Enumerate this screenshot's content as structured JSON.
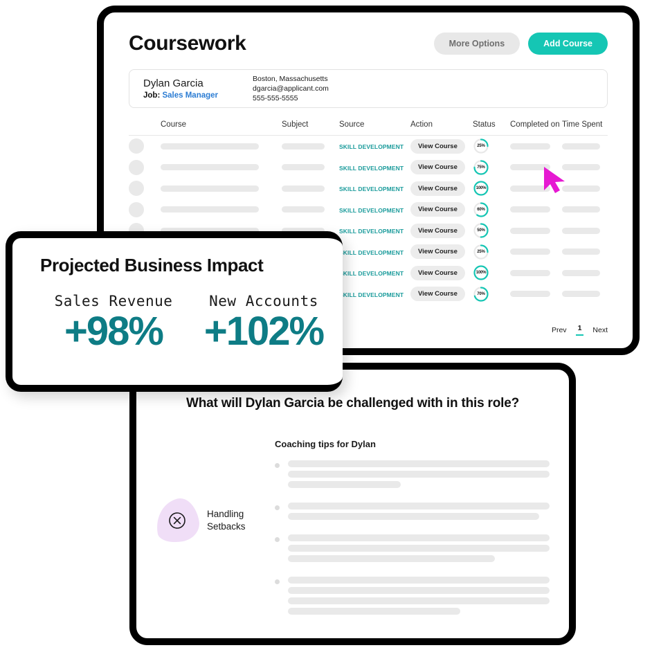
{
  "coursework": {
    "title": "Coursework",
    "more_options_label": "More Options",
    "add_course_label": "Add Course",
    "person": {
      "name": "Dylan Garcia",
      "job_prefix": "Job:",
      "job_title": "Sales Manager",
      "location": "Boston, Massachusetts",
      "email": "dgarcia@applicant.com",
      "phone": "555-555-5555"
    },
    "table": {
      "headers": [
        "Course",
        "Subject",
        "Source",
        "Action",
        "Status",
        "Completed on",
        "Time Spent"
      ],
      "source_label": "SKILL DEVELOPMENT",
      "action_label": "View Course",
      "rows": [
        {
          "status": "25%",
          "percent": 25
        },
        {
          "status": "75%",
          "percent": 75
        },
        {
          "status": "100%",
          "percent": 100
        },
        {
          "status": "60%",
          "percent": 60
        },
        {
          "status": "50%",
          "percent": 50
        },
        {
          "status": "25%",
          "percent": 25
        },
        {
          "status": "100%",
          "percent": 100
        },
        {
          "status": "70%",
          "percent": 70
        }
      ]
    },
    "pagination": {
      "prev": "Prev",
      "current": "1",
      "next": "Next"
    }
  },
  "impact": {
    "title": "Projected Business Impact",
    "metrics": [
      {
        "label": "Sales Revenue",
        "value": "+98%"
      },
      {
        "label": "New Accounts",
        "value": "+102%"
      }
    ]
  },
  "challenge": {
    "title": "What will Dylan Garcia be challenged with in this role?",
    "subtitle": "Coaching tips for Dylan",
    "topic_label": "Handling\nSetbacks",
    "topic_label_line1": "Handling",
    "topic_label_line2": "Setbacks",
    "tip_groups": [
      {
        "lines": [
          100,
          100,
          43
        ]
      },
      {
        "lines": [
          100,
          96
        ]
      },
      {
        "lines": [
          100,
          100,
          79
        ]
      },
      {
        "lines": [
          100,
          100,
          100,
          66
        ]
      }
    ]
  },
  "colors": {
    "teal": "#15c6b4",
    "teal_dark": "#0e7c85",
    "source_teal": "#1a9b9b",
    "link_blue": "#2b7cd3",
    "cursor_magenta": "#e619d2",
    "skeleton": "#e9e9e9",
    "blob_purple": "#f0def7"
  }
}
